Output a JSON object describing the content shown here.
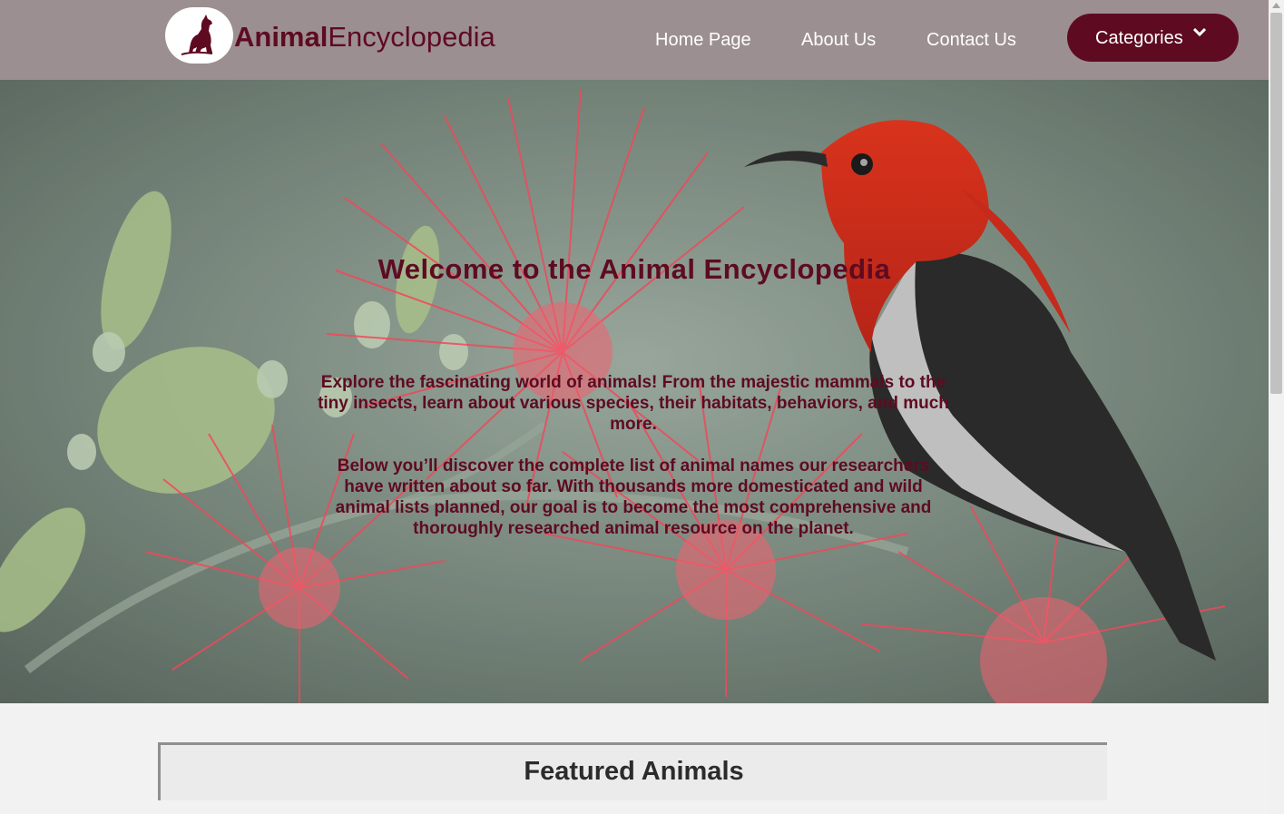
{
  "brand": {
    "part1": "Animal",
    "part2": "Encyclopedia",
    "logo_icon": "dog-silhouette-icon"
  },
  "nav": {
    "home": "Home Page",
    "about": "About Us",
    "contact": "Contact Us",
    "categories": "Categories",
    "categories_icon": "chevron-down-icon"
  },
  "hero": {
    "title": "Welcome to the Animal Encyclopedia",
    "paragraph1": "Explore the fascinating world of animals! From the majestic mammals to the tiny insects, learn about various species, their habitats, behaviors, and much more.",
    "paragraph2": "Below you’ll discover the complete list of animal names our researchers have written about so far. With thousands more domesticated and wild animal lists planned, our goal is to become the most comprehensive and thoroughly researched animal resource on the planet.",
    "background": "red-bird-on-bottlebrush-flower-photo"
  },
  "featured": {
    "heading": "Featured Animals"
  },
  "colors": {
    "header_bg": "#9c8f91",
    "accent": "#5e0b22",
    "page_bg": "#f2f2f2"
  }
}
